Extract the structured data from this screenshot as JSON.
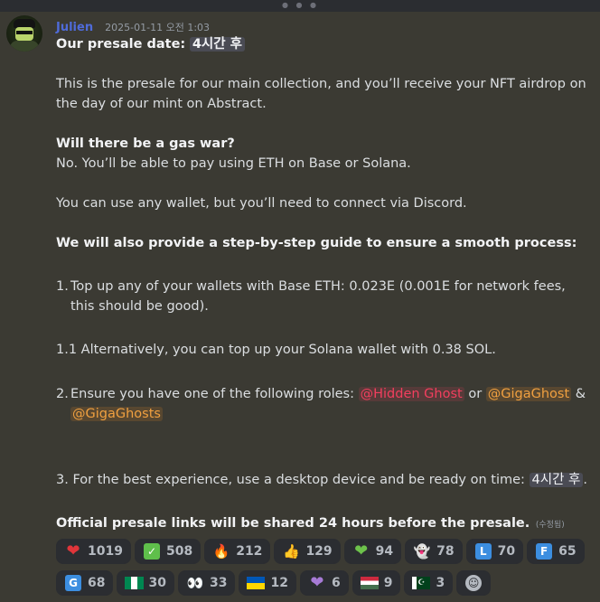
{
  "message": {
    "username": "Julien",
    "timestamp": "2025-01-11 오전 1:03",
    "line1_label": "Our presale date:",
    "line1_time": "4시간 후",
    "para1": "This is the presale for our main collection, and you’ll receive your NFT airdrop on the day of our mint on Abstract.",
    "gas_heading": "Will there be a gas war?",
    "gas_answer": "No. You’ll be able to pay using ETH on Base or Solana.",
    "wallet_line": "You can use any wallet, but you’ll need to connect via Discord.",
    "guide_heading": "We will also provide a step-by-step guide to ensure a smooth process:",
    "step1_prefix": "1.",
    "step1": "Top up any of your wallets with Base ETH: 0.023E (0.001E for network fees, this should be good).",
    "step1_1": "1.1 Alternatively, you can top up your Solana wallet with 0.38 SOL.",
    "step2_prefix": "2.",
    "step2_text": "Ensure you have one of the following roles:",
    "role1": "@Hidden Ghost",
    "or_word": "or",
    "role2": "@GigaGhost",
    "amp": "&",
    "role3": "@GigaGhosts",
    "step3_text": "3. For the best experience, use a desktop device and be ready on time:",
    "step3_time": "4시간 후",
    "step3_end": ".",
    "final_line": "Official presale links will be shared 24 hours before the presale.",
    "edited": "(수정됨)"
  },
  "reactions_row1": [
    {
      "icon": "red-heart-icon",
      "glyph": "❤",
      "count": "1019"
    },
    {
      "icon": "check-mark-icon",
      "glyph": "✓",
      "count": "508"
    },
    {
      "icon": "fire-icon",
      "glyph": "🔥",
      "count": "212"
    },
    {
      "icon": "thumbs-up-icon",
      "glyph": "👍",
      "count": "129"
    },
    {
      "icon": "green-heart-icon",
      "glyph": "❤",
      "count": "94"
    },
    {
      "icon": "ghost-icon",
      "glyph": "👻",
      "count": "78"
    },
    {
      "icon": "letter-l-icon",
      "glyph": "L",
      "count": "70"
    },
    {
      "icon": "letter-f-icon",
      "glyph": "F",
      "count": "65"
    }
  ],
  "reactions_row2": [
    {
      "icon": "letter-g-icon",
      "glyph": "G",
      "count": "68"
    },
    {
      "icon": "nigeria-flag-icon",
      "glyph": "",
      "count": "30"
    },
    {
      "icon": "eyes-icon",
      "glyph": "👀",
      "count": "33"
    },
    {
      "icon": "ukraine-flag-icon",
      "glyph": "",
      "count": "12"
    },
    {
      "icon": "purple-heart-icon",
      "glyph": "❤",
      "count": "6"
    },
    {
      "icon": "hungary-flag-icon",
      "glyph": "",
      "count": "9"
    },
    {
      "icon": "pakistan-flag-icon",
      "glyph": "☪",
      "count": "3"
    }
  ],
  "colors": {
    "background": "#3b3a33",
    "username": "#4f6bd9",
    "mention_red": "#f23f5e",
    "mention_orange": "#f0a040",
    "reaction_bg": "#2b2d31"
  }
}
